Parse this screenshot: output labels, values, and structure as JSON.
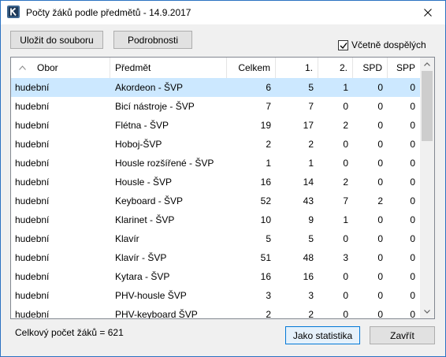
{
  "window": {
    "title": "Počty žáků podle předmětů - 14.9.2017",
    "app_icon_letter": "K"
  },
  "toolbar": {
    "save_label": "Uložit do souboru",
    "details_label": "Podrobnosti",
    "include_adults_label": "Včetně dospělých",
    "include_adults_checked": true
  },
  "table": {
    "columns": [
      "Obor",
      "Předmět",
      "Celkem",
      "1.",
      "2.",
      "SPD",
      "SPP"
    ],
    "sort_column": "Obor",
    "sort_direction": "ascending",
    "selected_row": 0,
    "rows": [
      [
        "hudební",
        "Akordeon - ŠVP",
        "6",
        "5",
        "1",
        "0",
        "0"
      ],
      [
        "hudební",
        "Bicí nástroje - ŠVP",
        "7",
        "7",
        "0",
        "0",
        "0"
      ],
      [
        "hudební",
        "Flétna - ŠVP",
        "19",
        "17",
        "2",
        "0",
        "0"
      ],
      [
        "hudební",
        "Hoboj-ŠVP",
        "2",
        "2",
        "0",
        "0",
        "0"
      ],
      [
        "hudební",
        "Housle rozšířené - ŠVP",
        "1",
        "1",
        "0",
        "0",
        "0"
      ],
      [
        "hudební",
        "Housle - ŠVP",
        "16",
        "14",
        "2",
        "0",
        "0"
      ],
      [
        "hudební",
        "Keyboard - ŠVP",
        "52",
        "43",
        "7",
        "2",
        "0"
      ],
      [
        "hudební",
        "Klarinet - ŠVP",
        "10",
        "9",
        "1",
        "0",
        "0"
      ],
      [
        "hudební",
        "Klavír",
        "5",
        "5",
        "0",
        "0",
        "0"
      ],
      [
        "hudební",
        "Klavír - ŠVP",
        "51",
        "48",
        "3",
        "0",
        "0"
      ],
      [
        "hudební",
        "Kytara - ŠVP",
        "16",
        "16",
        "0",
        "0",
        "0"
      ],
      [
        "hudební",
        "PHV-housle ŠVP",
        "3",
        "3",
        "0",
        "0",
        "0"
      ],
      [
        "hudební",
        "PHV-keyboard ŠVP",
        "2",
        "2",
        "0",
        "0",
        "0"
      ]
    ]
  },
  "footer": {
    "total_label": "Celkový počet žáků = 621",
    "statistics_label": "Jako statistika",
    "close_label": "Zavřít"
  },
  "colors": {
    "selection": "#cce8ff",
    "window_border": "#2b72c2",
    "default_button_border": "#0078d7"
  }
}
